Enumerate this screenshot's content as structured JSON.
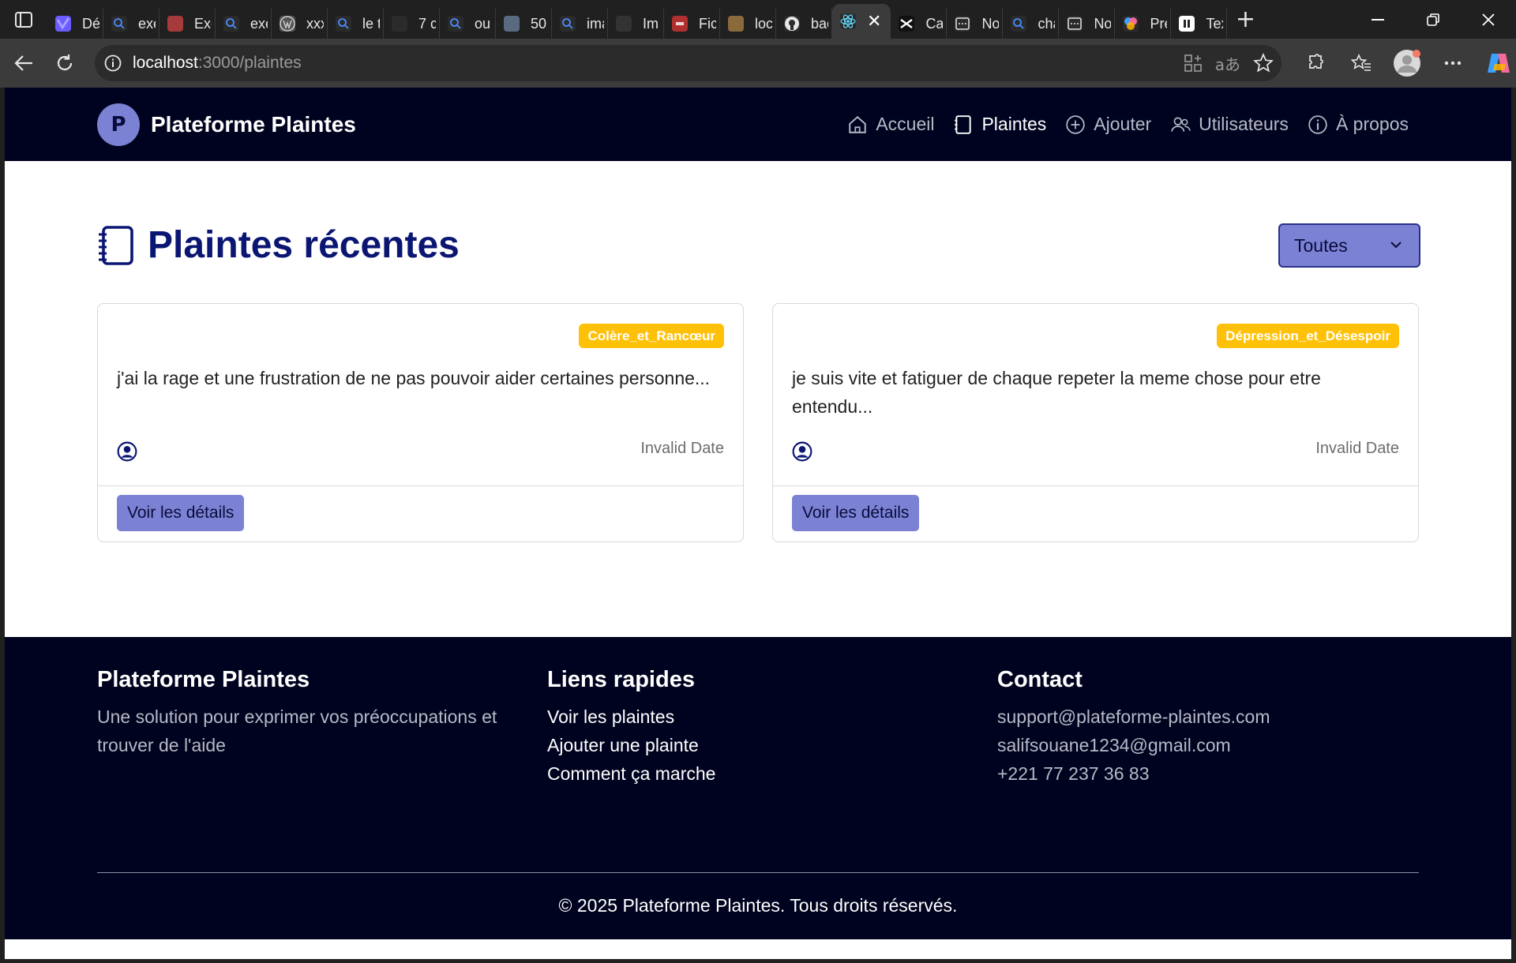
{
  "browser": {
    "tabs": [
      {
        "label": "Dé",
        "icon": "copilot-icon",
        "color": "#6b5cff"
      },
      {
        "label": "exe",
        "icon": "search-icon",
        "color": "#2b2b2b"
      },
      {
        "label": "Exe",
        "icon": "pycharm-icon",
        "color": "#a73a3a"
      },
      {
        "label": "exe",
        "icon": "search-icon",
        "color": "#2b2b2b"
      },
      {
        "label": "xxx",
        "icon": "wordpress-icon",
        "color": "#555555"
      },
      {
        "label": "le t",
        "icon": "search-icon",
        "color": "#2b2b2b"
      },
      {
        "label": "7 c",
        "icon": "arrow-logo-icon",
        "color": "#2b2b2b"
      },
      {
        "label": "ou",
        "icon": "search-icon",
        "color": "#2b2b2b"
      },
      {
        "label": "50",
        "icon": "image-thumb-icon",
        "color": "#5a6a80"
      },
      {
        "label": "ima",
        "icon": "search-icon",
        "color": "#2b2b2b"
      },
      {
        "label": "Im",
        "icon": "image-thumb-icon",
        "color": "#333333"
      },
      {
        "label": "Fic",
        "icon": "pdf-icon",
        "color": "#b03030"
      },
      {
        "label": "loc",
        "icon": "image-thumb-icon",
        "color": "#8a6a3a"
      },
      {
        "label": "bac",
        "icon": "github-icon",
        "color": "#2b2b2b"
      },
      {
        "label": "",
        "icon": "react-icon",
        "color": "#2b2b2b",
        "active": true
      },
      {
        "label": "Ca",
        "icon": "capcut-icon",
        "color": "#111111"
      },
      {
        "label": "No",
        "icon": "note-icon",
        "color": "#2b2b2b"
      },
      {
        "label": "cha",
        "icon": "search-icon",
        "color": "#2b2b2b"
      },
      {
        "label": "No",
        "icon": "note-icon",
        "color": "#2b2b2b"
      },
      {
        "label": "Pré",
        "icon": "gemini-icon",
        "color": "#2b2b2b"
      },
      {
        "label": "Tex",
        "icon": "pause-icon",
        "color": "#ffffff"
      }
    ],
    "url_host": "localhost",
    "url_path": ":3000/plaintes"
  },
  "nav": {
    "logo_letter": "P",
    "brand": "Plateforme Plaintes",
    "links": [
      {
        "label": "Accueil",
        "icon": "home-icon"
      },
      {
        "label": "Plaintes",
        "icon": "notebook-icon",
        "active": true
      },
      {
        "label": "Ajouter",
        "icon": "plus-circle-icon"
      },
      {
        "label": "Utilisateurs",
        "icon": "users-icon"
      },
      {
        "label": "À propos",
        "icon": "info-icon"
      }
    ]
  },
  "main": {
    "title": "Plaintes récentes",
    "filter_value": "Toutes",
    "cards": [
      {
        "badge": "Colère_et_Rancœur",
        "text": "j'ai la rage et une frustration de ne pas pouvoir aider certaines personne...",
        "date": "Invalid Date",
        "button": "Voir les détails"
      },
      {
        "badge": "Dépression_et_Désespoir",
        "text": "je suis vite et fatiguer de chaque repeter la meme chose pour etre entendu...",
        "date": "Invalid Date",
        "button": "Voir les détails"
      }
    ]
  },
  "footer": {
    "about_title": "Plateforme Plaintes",
    "about_text": "Une solution pour exprimer vos préoccupations et trouver de l'aide",
    "links_title": "Liens rapides",
    "links": [
      "Voir les plaintes",
      "Ajouter une plainte",
      "Comment ça marche"
    ],
    "contact_title": "Contact",
    "contact": [
      "support@plateforme-plaintes.com",
      "salifsouane1234@gmail.com",
      "+221 77 237 36 83"
    ],
    "copyright": "© 2025 Plateforme Plaintes. Tous droits réservés."
  },
  "colors": {
    "navy": "#00031f",
    "accent": "#7b82d3",
    "title": "#0b1673",
    "badge": "#ffc107"
  }
}
